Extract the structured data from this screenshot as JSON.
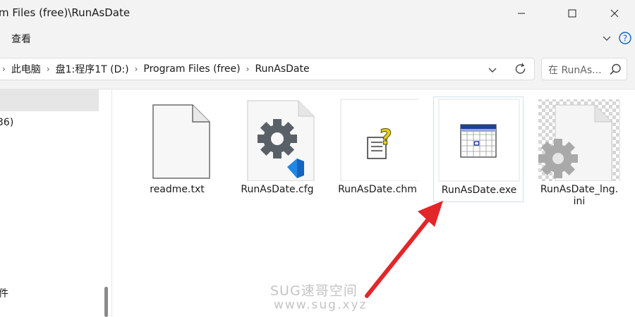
{
  "window": {
    "title": "m Files (free)\\RunAsDate"
  },
  "toolbar": {
    "view_menu": "查看"
  },
  "address": {
    "crumbs": [
      "此电脑",
      "盘1:程序1T (D:)",
      "Program Files (free)",
      "RunAsDate"
    ]
  },
  "search": {
    "placeholder": "在 RunAs..."
  },
  "nav": {
    "partial_item_1": "36)",
    "partial_item_2": "件"
  },
  "files": [
    {
      "name": "readme.txt",
      "type": "text-file-icon"
    },
    {
      "name": "RunAsDate.cfg",
      "type": "vscode-config-gear-icon"
    },
    {
      "name": "RunAsDate.chm",
      "type": "help-file-icon"
    },
    {
      "name": "RunAsDate.exe",
      "type": "calendar-app-icon",
      "selected": true
    },
    {
      "name": "RunAsDate_lng.\nini",
      "type": "settings-file-icon"
    }
  ],
  "watermark": {
    "line1": "SUG速哥空间",
    "line2": "www.sug.xyz"
  },
  "colors": {
    "accent": "#0a64c8",
    "arrow": "#e3262a",
    "chrome": "#f3f3f3",
    "selection_border": "#cfe1e6"
  }
}
